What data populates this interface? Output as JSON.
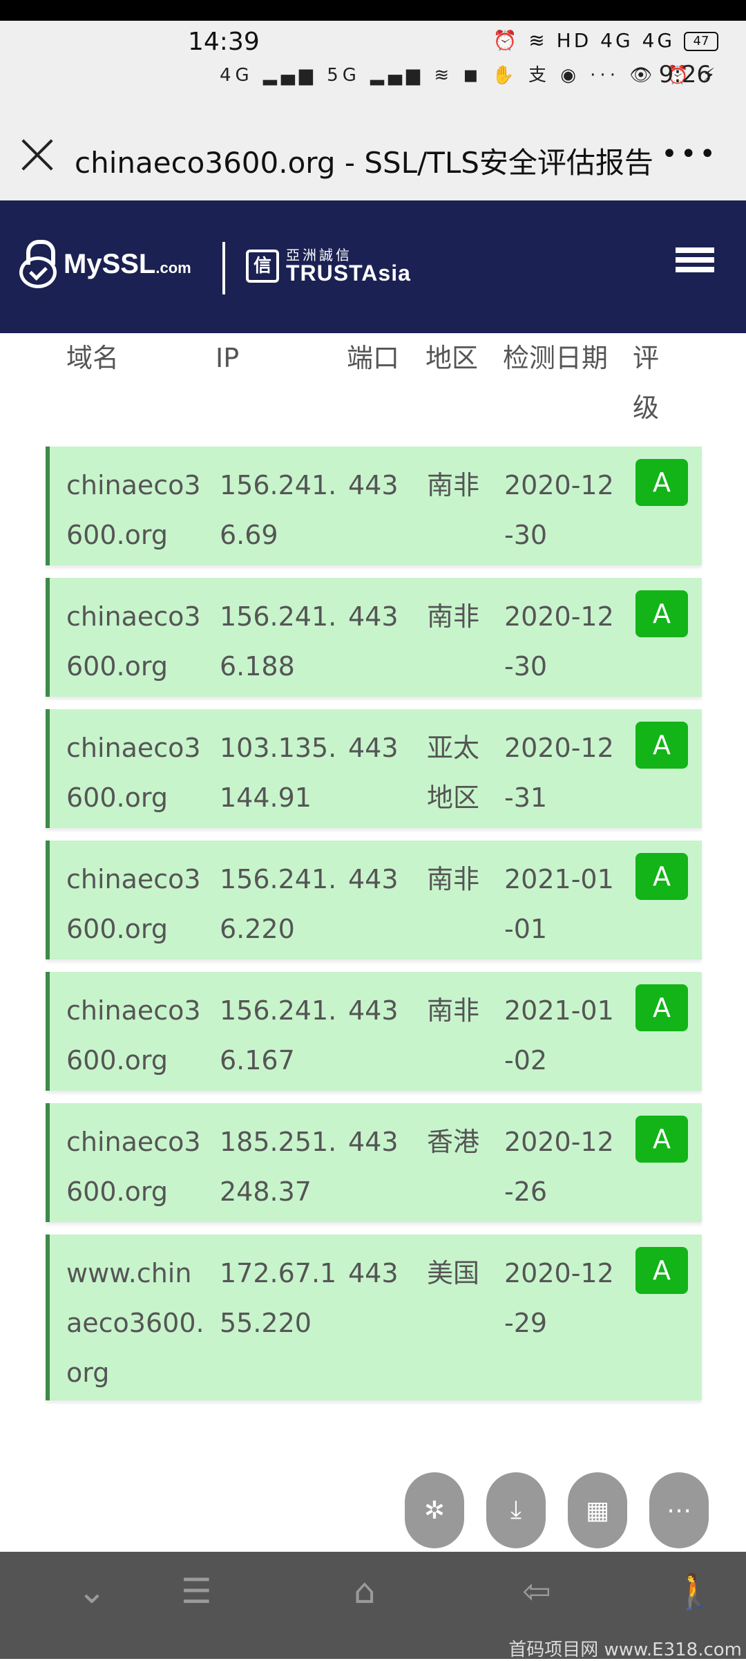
{
  "status_bar": {
    "time": "14:39",
    "time2": "9:26",
    "right_icons": "⏰ ≋ HD 4G 4G",
    "battery": "47",
    "row2_icons": "4G ▂▄▆ 5G ▂▄▆ ≋ ◼ ✋ 支 ◉ ··· 👁 ⏰ ⚡"
  },
  "browser": {
    "page_title": "chinaeco3600.org - SSL/TLS安全评估报告",
    "more": "•••"
  },
  "site_header": {
    "logo_main": "MySSL",
    "logo_suffix": ".com",
    "partner_cn": "亞洲誠信",
    "partner_en": "TRUSTAsia",
    "partner_badge": "信"
  },
  "table": {
    "headers": {
      "domain": "域名",
      "ip": "IP",
      "port": "端口",
      "region": "地区",
      "date": "检测日期",
      "grade": "评级"
    },
    "rows": [
      {
        "domain": "chinaeco3600.org",
        "ip": "156.241.6.69",
        "port": "443",
        "region": "南非",
        "date": "2020-12-30",
        "grade": "A"
      },
      {
        "domain": "chinaeco3600.org",
        "ip": "156.241.6.188",
        "port": "443",
        "region": "南非",
        "date": "2020-12-30",
        "grade": "A"
      },
      {
        "domain": "chinaeco3600.org",
        "ip": "103.135.144.91",
        "port": "443",
        "region": "亚太地区",
        "date": "2020-12-31",
        "grade": "A"
      },
      {
        "domain": "chinaeco3600.org",
        "ip": "156.241.6.220",
        "port": "443",
        "region": "南非",
        "date": "2021-01-01",
        "grade": "A"
      },
      {
        "domain": "chinaeco3600.org",
        "ip": "156.241.6.167",
        "port": "443",
        "region": "南非",
        "date": "2021-01-02",
        "grade": "A"
      },
      {
        "domain": "chinaeco3600.org",
        "ip": "185.251.248.37",
        "port": "443",
        "region": "香港",
        "date": "2020-12-26",
        "grade": "A"
      },
      {
        "domain": "www.chinaeco3600.org",
        "ip": "172.67.155.220",
        "port": "443",
        "region": "美国",
        "date": "2020-12-29",
        "grade": "A"
      }
    ]
  },
  "floating_buttons": [
    "✲",
    "⤓",
    "▦",
    "⋯"
  ],
  "nav_bar": {
    "back": "⌄",
    "menu": "☰",
    "home": "⌂",
    "return": "⇦",
    "accessibility": "🚶"
  },
  "watermark": "首码项目网 www.E318.com",
  "colors": {
    "header_bg": "#1b2152",
    "row_bg": "#c8f4cc",
    "row_border": "#3d8a47",
    "grade_bg": "#12b418"
  }
}
